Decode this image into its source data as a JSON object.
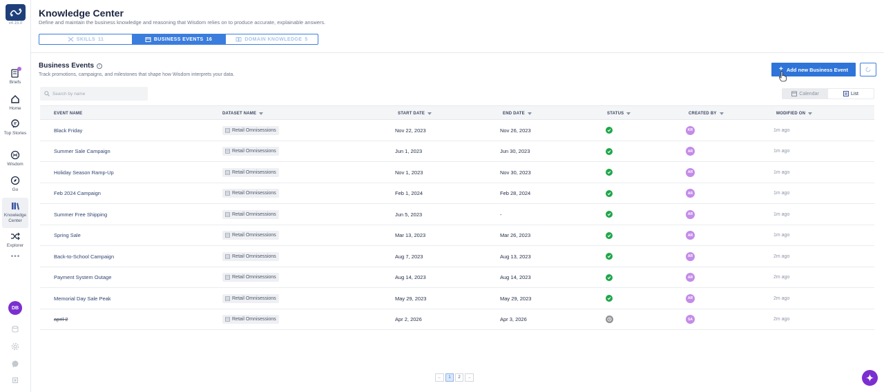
{
  "sidebar": {
    "version": "v4.15.0",
    "items": [
      {
        "label": "Briefs"
      },
      {
        "label": "Home"
      },
      {
        "label": "Top Stories"
      },
      {
        "label": "Wisdom"
      },
      {
        "label": "Go"
      },
      {
        "label": "Knowledge Center"
      },
      {
        "label": "Explorer"
      }
    ],
    "more": "•••",
    "user_initials": "DB"
  },
  "header": {
    "title": "Knowledge Center",
    "subtitle": "Define and maintain the business knowledge and reasoning that Wisdom relies on to produce accurate, explainable answers.",
    "tabs": [
      {
        "label": "SKILLS",
        "count": "11"
      },
      {
        "label": "BUSINESS EVENTS",
        "count": "16"
      },
      {
        "label": "DOMAIN KNOWLEDGE",
        "count": "5"
      }
    ]
  },
  "section": {
    "title": "Business Events",
    "subtitle": "Track promotions, campaigns, and milestones that shape how Wisdom interprets your data.",
    "add_button": "Add new Business Event",
    "search_placeholder": "Search by name",
    "view_calendar": "Calendar",
    "view_list": "List"
  },
  "table": {
    "columns": [
      "EVENT NAME",
      "DATASET NAME",
      "START DATE",
      "END DATE",
      "STATUS",
      "CREATED BY",
      "MODIFIED ON"
    ],
    "rows": [
      {
        "name": "Black Friday",
        "dataset": "Retail Omnisessions",
        "start": "Nov 22, 2023",
        "end": "Nov 26, 2023",
        "status": "active",
        "by": "KR",
        "modified": "1m ago"
      },
      {
        "name": "Summer Sale Campaign",
        "dataset": "Retail Omnisessions",
        "start": "Jun 1, 2023",
        "end": "Jun 30, 2023",
        "status": "active",
        "by": "AR",
        "modified": "1m ago"
      },
      {
        "name": "Holiday Season Ramp-Up",
        "dataset": "Retail Omnisessions",
        "start": "Nov 1, 2023",
        "end": "Nov 30, 2023",
        "status": "active",
        "by": "AR",
        "modified": "1m ago"
      },
      {
        "name": "Feb 2024 Campaign",
        "dataset": "Retail Omnisessions",
        "start": "Feb 1, 2024",
        "end": "Feb 28, 2024",
        "status": "active",
        "by": "AR",
        "modified": "1m ago"
      },
      {
        "name": "Summer Free Shipping",
        "dataset": "Retail Omnisessions",
        "start": "Jun 5, 2023",
        "end": "-",
        "status": "active",
        "by": "AR",
        "modified": "1m ago"
      },
      {
        "name": "Spring Sale",
        "dataset": "Retail Omnisessions",
        "start": "Mar 13, 2023",
        "end": "Mar 26, 2023",
        "status": "active",
        "by": "AR",
        "modified": "1m ago"
      },
      {
        "name": "Back-to-School Campaign",
        "dataset": "Retail Omnisessions",
        "start": "Aug 7, 2023",
        "end": "Aug 13, 2023",
        "status": "active",
        "by": "AR",
        "modified": "2m ago"
      },
      {
        "name": "Payment System Outage",
        "dataset": "Retail Omnisessions",
        "start": "Aug 14, 2023",
        "end": "Aug 14, 2023",
        "status": "active",
        "by": "AR",
        "modified": "2m ago"
      },
      {
        "name": "Memorial Day Sale Peak",
        "dataset": "Retail Omnisessions",
        "start": "May 29, 2023",
        "end": "May 29, 2023",
        "status": "active",
        "by": "AR",
        "modified": "2m ago"
      },
      {
        "name": "april 2",
        "dataset": "Retail Omnisessions",
        "start": "Apr 2, 2026",
        "end": "Apr 3, 2026",
        "status": "pending",
        "by": "SA",
        "modified": "2m ago"
      }
    ]
  },
  "pagination": {
    "pages": [
      "1",
      "2"
    ],
    "prev": "←",
    "next": "→"
  },
  "colors": {
    "accent": "#2f74d8",
    "status_ok": "#1fa64a",
    "avatar": "#c48be8",
    "brand": "#1f3f7a",
    "fab": "#7b2fd0"
  }
}
